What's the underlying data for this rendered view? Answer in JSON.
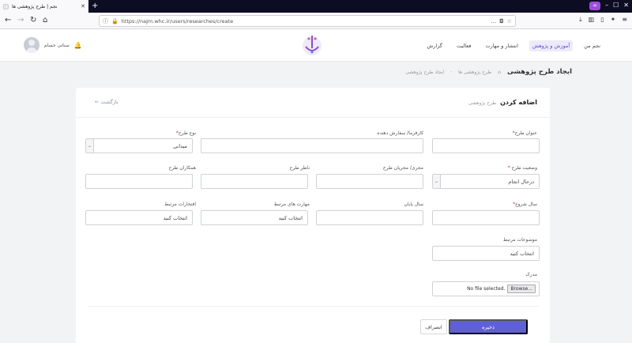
{
  "browser": {
    "tab_title": "نجم | طرح پژوهشی ها",
    "url": "https://najm.whc.ir/users/researches/create"
  },
  "header": {
    "menu": [
      "نجم من",
      "آموزش و پژوهش",
      "انتشار و مهارت",
      "فعالیت",
      "گزارش"
    ],
    "user_name": "سناتی حسام"
  },
  "breadcrumb": {
    "page_title": "ایجاد طرح پژوهشی",
    "items": [
      "طرح پژوهشی ها",
      "ایجاد طرح پژوهشی"
    ]
  },
  "card": {
    "title": "اضافه کردن",
    "subtitle": "طرح پژوهشی",
    "back_label": "بازگشت"
  },
  "form": {
    "title_label": "عنوان طرح",
    "employer_label": "کارفرما/ سفارش دهنده",
    "type_label": "نوع طرح",
    "type_value": "میدانی",
    "status_label": "وضعیت طرح",
    "status_value": "درحال انجام",
    "executor_label": "مجری/ مجریان طرح",
    "supervisor_label": "ناظر طرح",
    "colleagues_label": "همکاران طرح",
    "start_year_label": "سال شروع",
    "end_year_label": "سال پایان",
    "skills_label": "مهارت های مرتبط",
    "skills_placeholder": "انتخاب کنید",
    "honors_label": "افتخارات مرتبط",
    "honors_placeholder": "انتخاب کنید",
    "topics_label": "موضوعات مرتبط",
    "topics_placeholder": "انتخاب کنید",
    "document_label": "مدرک",
    "file_status": "No file selected.",
    "browse_label": "Browse..."
  },
  "actions": {
    "save_label": "ذخیره",
    "cancel_label": "انصراف"
  },
  "colors": {
    "accent": "#6060d6",
    "active_menu_bg": "#eeeafc",
    "required": "#d33"
  }
}
